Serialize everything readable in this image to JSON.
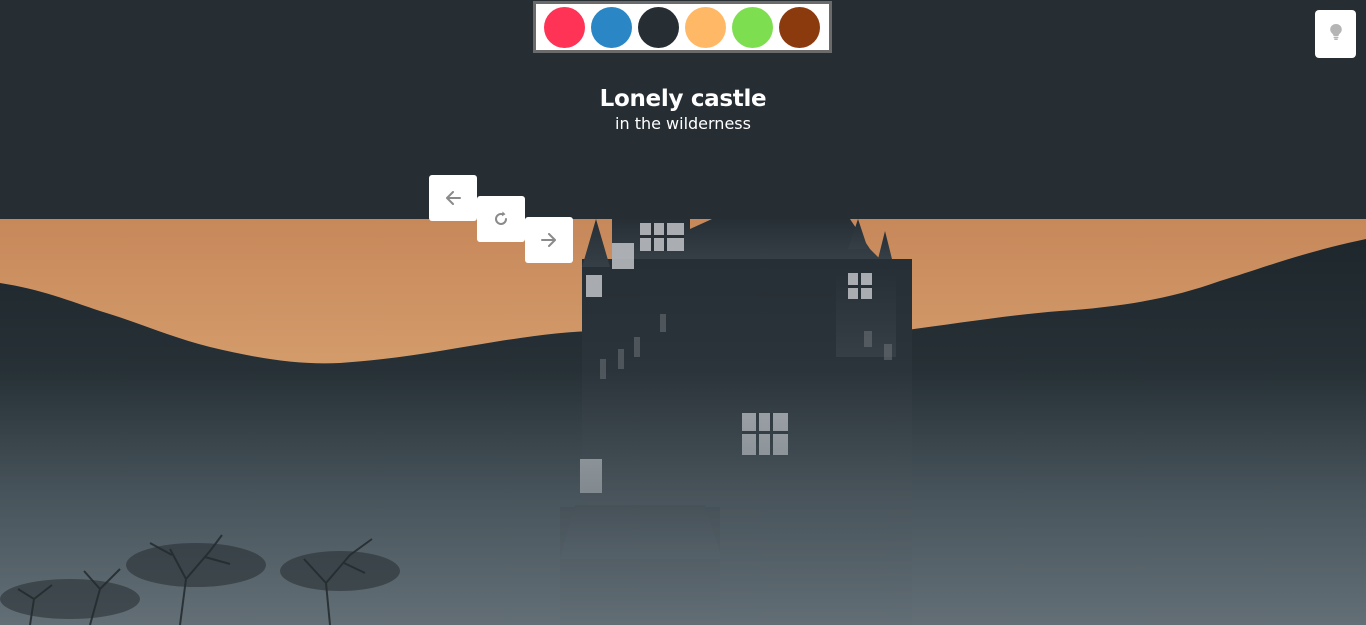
{
  "palette": {
    "swatches": [
      {
        "name": "red",
        "color": "#ff3355"
      },
      {
        "name": "blue",
        "color": "#2b86c5"
      },
      {
        "name": "dark",
        "color": "#262d33"
      },
      {
        "name": "orange",
        "color": "#ffb866"
      },
      {
        "name": "green",
        "color": "#7ddf4f"
      },
      {
        "name": "brown",
        "color": "#8b3a0e"
      }
    ]
  },
  "header": {
    "title": "Lonely castle",
    "subtitle": "in the wilderness",
    "background": "#262d33"
  },
  "controls": {
    "prev_icon": "arrow-left-icon",
    "reload_icon": "reload-icon",
    "next_icon": "arrow-right-icon",
    "theme_icon": "lightbulb-icon"
  },
  "scene": {
    "image": "castle-in-fog-at-sunset"
  }
}
